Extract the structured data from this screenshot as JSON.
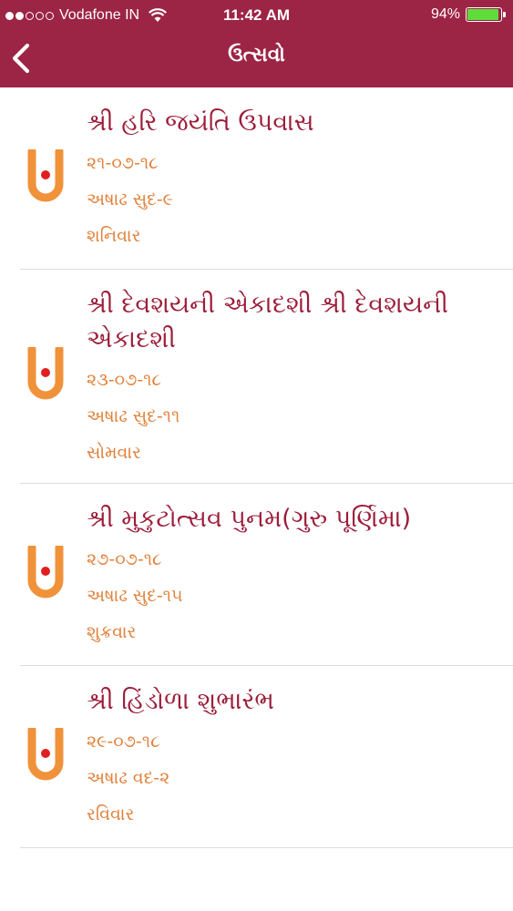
{
  "status_bar": {
    "signal_dots_full": 2,
    "signal_dots_total": 5,
    "carrier": "Vodafone IN",
    "time": "11:42 AM",
    "battery_percent": "94%",
    "battery_level": 0.94,
    "battery_color": "#5fdc3a"
  },
  "nav": {
    "title": "ઉત્સવો",
    "back_icon": "chevron-left-icon",
    "background": "#9c2444"
  },
  "colors": {
    "title_text": "#9c1e3a",
    "detail_text": "#e1813a",
    "logo_orange": "#f0923a",
    "logo_dot": "#e02020"
  },
  "festivals": [
    {
      "title": "શ્રી હરિ જયંતિ ઉપવાસ",
      "date": "૨૧-૦૭-૧૮",
      "tithi": "અષાઢ સુદ-૯",
      "weekday": "શનિવાર"
    },
    {
      "title": "શ્રી દેવશયની એકાદશી શ્રી દેવશયની એકાદશી",
      "date": "૨૩-૦૭-૧૮",
      "tithi": "અષાઢ સુદ-૧૧",
      "weekday": "સોમવાર"
    },
    {
      "title": "શ્રી મુકુટોત્સવ પુનમ(ગુરુ પૂર્ણિમા)",
      "date": "૨૭-૦૭-૧૮",
      "tithi": "અષાઢ સુદ-૧૫",
      "weekday": "શુક્રવાર"
    },
    {
      "title": "શ્રી હિંડોળા શુભારંભ",
      "date": "૨૯-૦૭-૧૮",
      "tithi": "અષાઢ વદ-૨",
      "weekday": "રવિવાર"
    }
  ]
}
